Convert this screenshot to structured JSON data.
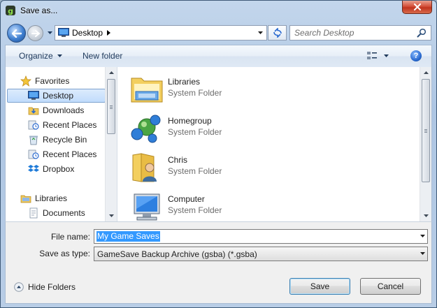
{
  "window": {
    "title": "Save as...",
    "colors": {
      "titlebar": "#aec6e3",
      "close_button": "#c0341e",
      "selection": "#3399ff"
    }
  },
  "address_bar": {
    "location": "Desktop",
    "search_placeholder": "Search Desktop"
  },
  "toolbar": {
    "organize_label": "Organize",
    "new_folder_label": "New folder",
    "help_label": "?"
  },
  "nav_pane": {
    "items": [
      {
        "label": "Favorites",
        "icon": "star-icon",
        "group": true
      },
      {
        "label": "Desktop",
        "icon": "desktop-icon",
        "selected": true
      },
      {
        "label": "Downloads",
        "icon": "downloads-icon"
      },
      {
        "label": "Recent Places",
        "icon": "recent-places-icon"
      },
      {
        "label": "Recycle Bin",
        "icon": "recycle-bin-icon"
      },
      {
        "label": "Recent Places",
        "icon": "recent-places-icon"
      },
      {
        "label": "Dropbox",
        "icon": "dropbox-icon"
      },
      {
        "label": "Libraries",
        "icon": "libraries-icon",
        "group": true
      },
      {
        "label": "Documents",
        "icon": "documents-icon"
      }
    ]
  },
  "file_list": {
    "items": [
      {
        "name": "Libraries",
        "type": "System Folder",
        "icon": "libraries-folder-icon"
      },
      {
        "name": "Homegroup",
        "type": "System Folder",
        "icon": "homegroup-icon"
      },
      {
        "name": "Chris",
        "type": "System Folder",
        "icon": "user-folder-icon"
      },
      {
        "name": "Computer",
        "type": "System Folder",
        "icon": "computer-icon"
      }
    ]
  },
  "form": {
    "file_name_label": "File name:",
    "file_name_value": "My Game Saves",
    "save_as_type_label": "Save as type:",
    "save_as_type_value": "GameSave Backup Archive (gsba) (*.gsba)"
  },
  "footer": {
    "hide_folders_label": "Hide Folders",
    "save_label": "Save",
    "cancel_label": "Cancel"
  }
}
